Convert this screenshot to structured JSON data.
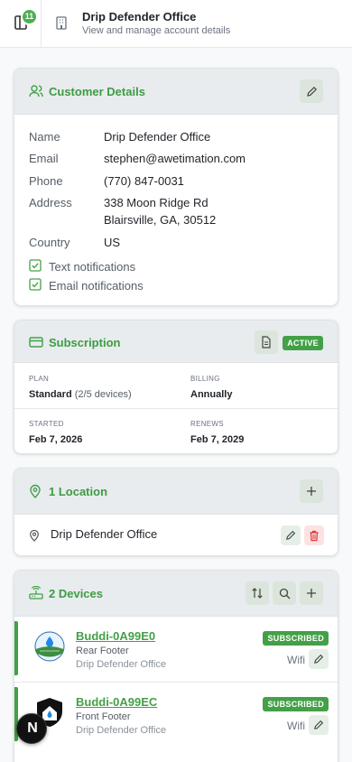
{
  "header": {
    "badge_count": "11",
    "title": "Drip Defender Office",
    "subtitle": "View and manage account details"
  },
  "customer": {
    "section_title": "Customer Details",
    "fields": [
      {
        "label": "Name",
        "value": "Drip Defender Office"
      },
      {
        "label": "Email",
        "value": "stephen@awetimation.com"
      },
      {
        "label": "Phone",
        "value": "(770) 847-0031"
      },
      {
        "label": "Address",
        "value": "338 Moon Ridge Rd",
        "value2": "Blairsville, GA, 30512"
      },
      {
        "label": "Country",
        "value": "US"
      }
    ],
    "notifications": [
      {
        "label": "Text notifications",
        "checked": true
      },
      {
        "label": "Email notifications",
        "checked": true
      }
    ]
  },
  "subscription": {
    "section_title": "Subscription",
    "status": "ACTIVE",
    "plan_label": "PLAN",
    "plan_value": "Standard",
    "plan_devices": "(2/5 devices)",
    "billing_label": "BILLING",
    "billing_value": "Annually",
    "started_label": "STARTED",
    "started_value": "Feb 7, 2026",
    "renews_label": "RENEWS",
    "renews_value": "Feb 7, 2029"
  },
  "locations": {
    "section_title": "1 Location",
    "items": [
      {
        "name": "Drip Defender Office"
      }
    ]
  },
  "devices": {
    "section_title": "2 Devices",
    "items": [
      {
        "name": "Buddi-0A99E0",
        "type": "Rear Footer",
        "location": "Drip Defender Office",
        "status": "SUBSCRIBED",
        "connection": "Wifi"
      },
      {
        "name": "Buddi-0A99EC",
        "type": "Front Footer",
        "location": "Drip Defender Office",
        "status": "SUBSCRIBED",
        "connection": "Wifi"
      }
    ]
  },
  "fab": {
    "label": "N"
  },
  "colors": {
    "accent": "#43a047",
    "header_bg": "#e8ecee",
    "danger_bg": "#fde2e2"
  }
}
